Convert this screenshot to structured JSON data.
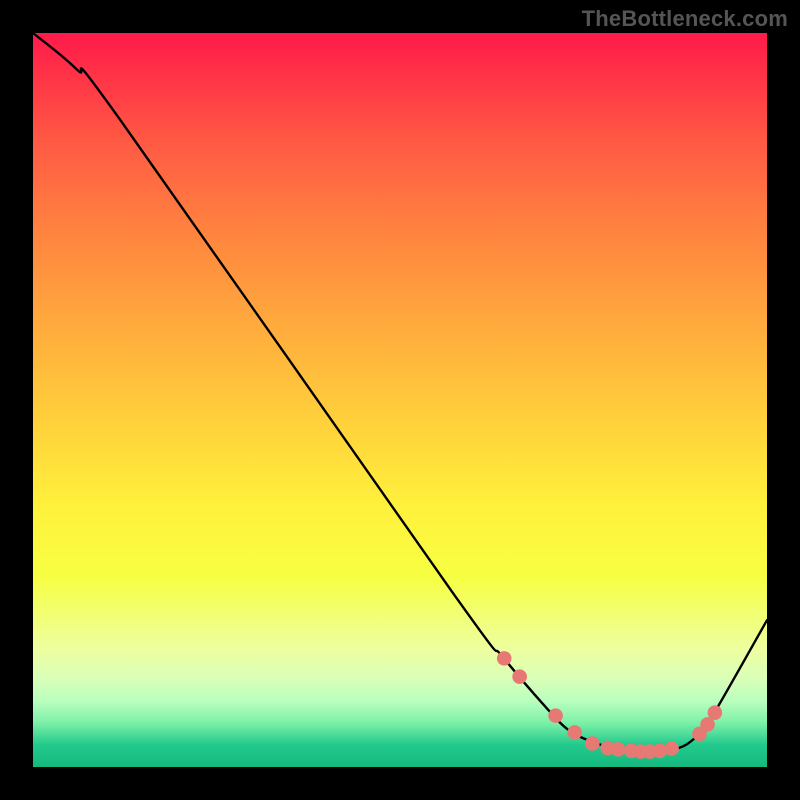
{
  "watermark": "TheBottleneck.com",
  "colors": {
    "frame_bg": "#000000",
    "gradient_top": "#ff1a4b",
    "gradient_bottom": "#15b97f",
    "curve_stroke": "#000000",
    "marker_fill": "#e77974"
  },
  "chart_data": {
    "type": "line",
    "title": "",
    "xlabel": "",
    "ylabel": "",
    "xlim": [
      0,
      100
    ],
    "ylim": [
      0,
      100
    ],
    "series": [
      {
        "name": "curve",
        "x": [
          0,
          6,
          12,
          57,
          64,
          70,
          73,
          76,
          79,
          82,
          85,
          88,
          90,
          92,
          100
        ],
        "y": [
          100,
          95,
          88,
          24,
          15,
          8,
          5,
          3.5,
          2.6,
          2.2,
          2.2,
          2.6,
          3.8,
          6,
          20
        ]
      }
    ],
    "markers": [
      {
        "x": 64.2,
        "y": 14.8
      },
      {
        "x": 66.3,
        "y": 12.3
      },
      {
        "x": 71.2,
        "y": 7.0
      },
      {
        "x": 73.8,
        "y": 4.7
      },
      {
        "x": 76.2,
        "y": 3.2
      },
      {
        "x": 78.3,
        "y": 2.6
      },
      {
        "x": 79.7,
        "y": 2.4
      },
      {
        "x": 81.5,
        "y": 2.2
      },
      {
        "x": 82.8,
        "y": 2.1
      },
      {
        "x": 84.0,
        "y": 2.1
      },
      {
        "x": 85.4,
        "y": 2.2
      },
      {
        "x": 87.0,
        "y": 2.5
      },
      {
        "x": 90.8,
        "y": 4.5
      },
      {
        "x": 91.9,
        "y": 5.8
      },
      {
        "x": 92.9,
        "y": 7.4
      }
    ],
    "grid": false,
    "legend": false
  }
}
